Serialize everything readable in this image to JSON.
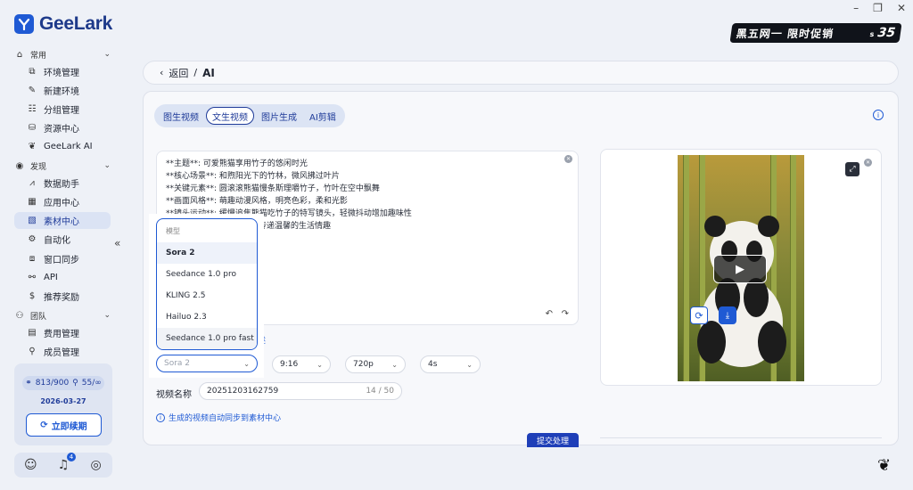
{
  "app": {
    "logo_text": "GeeLark"
  },
  "window_controls": {
    "restore": "⧉",
    "minimize": "–",
    "maximize": "❐",
    "close": "✕"
  },
  "promo": {
    "text": "黑五网一 限时促销",
    "s_label": "s",
    "number": "35"
  },
  "sidebar": {
    "collapse_glyph": "«",
    "sections": {
      "common": {
        "label": "常用"
      },
      "discover": {
        "label": "发现"
      },
      "team": {
        "label": "团队"
      }
    },
    "items": [
      {
        "label": "环境管理"
      },
      {
        "label": "新建环境"
      },
      {
        "label": "分组管理"
      },
      {
        "label": "资源中心"
      },
      {
        "label": "GeeLark AI"
      },
      {
        "label": "数据助手"
      },
      {
        "label": "应用中心"
      },
      {
        "label": "素材中心"
      },
      {
        "label": "自动化"
      },
      {
        "label": "窗口同步"
      },
      {
        "label": "API"
      },
      {
        "label": "推荐奖励"
      },
      {
        "label": "费用管理"
      },
      {
        "label": "成员管理"
      }
    ],
    "plan": {
      "devices": "813/900",
      "members": "55/∞",
      "expiry": "2026-03-27",
      "renew_label": "立即续期"
    },
    "bottom": {
      "notification_count": "4"
    }
  },
  "breadcrumb": {
    "back": "返回",
    "sep": "/",
    "current": "AI"
  },
  "tabs": [
    {
      "label": "图生视频"
    },
    {
      "label": "文生视频"
    },
    {
      "label": "图片生成"
    },
    {
      "label": "AI剪辑"
    }
  ],
  "prompt_lines": [
    "**主题**: 可爱熊猫享用竹子的悠闲时光",
    "**核心场景**: 和煦阳光下的竹林，微风拂过叶片",
    "**关键元素**: 圆滚滚熊猫慢条斯理嚼竹子，竹叶在空中飘舞",
    "**画面风格**: 萌趣动漫风格，明亮色彩，柔和光影",
    "**镜头运动**: 缓慢追焦熊猫吃竹子的特写镜头，轻微抖动增加趣味性",
    "传递温馨的生活情趣"
  ],
  "partial_link": "述",
  "settings": {
    "model_placeholder": "Sora 2",
    "ratio": "9:16",
    "resolution": "720p",
    "duration": "4s"
  },
  "video_name": {
    "label": "视频名称",
    "value": "20251203162759",
    "count": "14 / 50"
  },
  "sync_note": "生成的视频自动同步到素材中心",
  "submit_label": "提交处理",
  "dropdown": {
    "header": "模型",
    "options": [
      {
        "label": "Sora 2"
      },
      {
        "label": "Seedance 1.0 pro"
      },
      {
        "label": "KLING 2.5"
      },
      {
        "label": "Hailuo 2.3"
      },
      {
        "label": "Seedance 1.0 pro fast"
      }
    ]
  }
}
